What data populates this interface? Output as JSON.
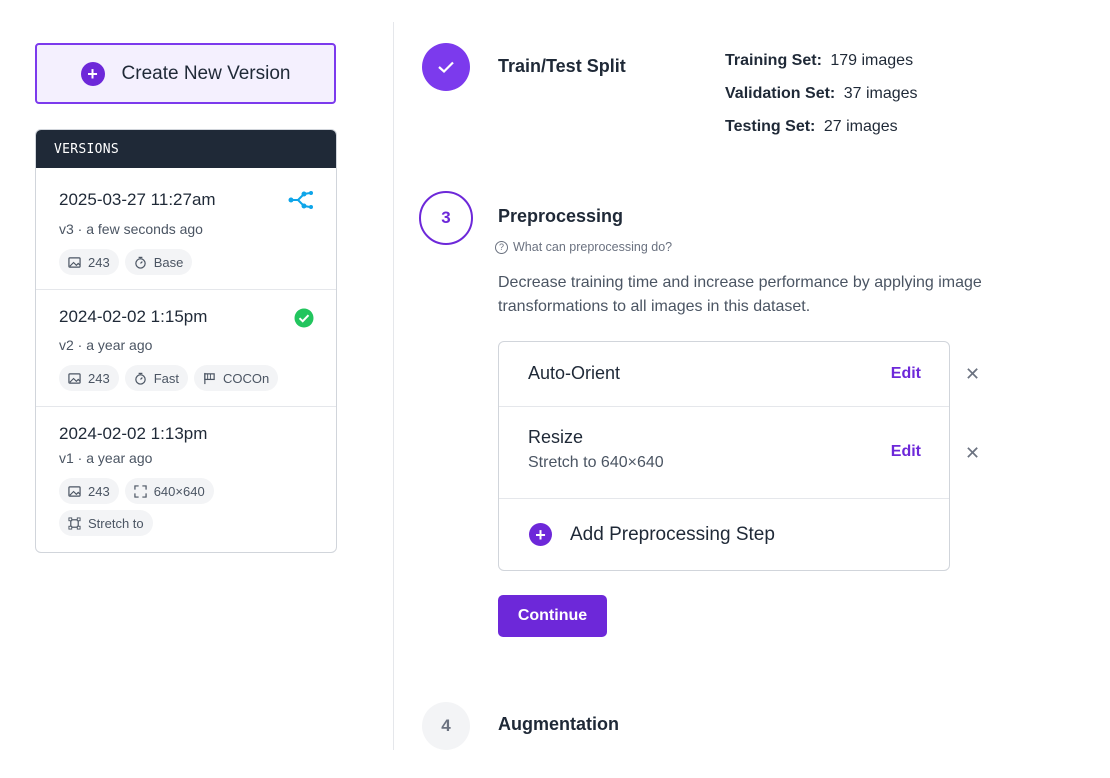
{
  "sidebar": {
    "create_label": "Create New Version",
    "versions_header": "VERSIONS",
    "versions": [
      {
        "date": "2025-03-27 11:27am",
        "subtitle": "v3 · a few seconds ago",
        "status_icon": "network-graph-icon",
        "tags": [
          {
            "icon": "image-icon",
            "text": "243"
          },
          {
            "icon": "timer-icon",
            "text": "Base"
          }
        ]
      },
      {
        "date": "2024-02-02 1:15pm",
        "subtitle": "v2 · a year ago",
        "status_icon": "check-circle-icon",
        "tags": [
          {
            "icon": "image-icon",
            "text": "243"
          },
          {
            "icon": "timer-icon",
            "text": "Fast"
          },
          {
            "icon": "flag-icon",
            "text": "COCOn"
          }
        ]
      },
      {
        "date": "2024-02-02 1:13pm",
        "subtitle": "v1 · a year ago",
        "status_icon": "",
        "tags": [
          {
            "icon": "image-icon",
            "text": "243"
          },
          {
            "icon": "expand-icon",
            "text": "640×640"
          },
          {
            "icon": "crop-icon",
            "text": "Stretch to"
          }
        ]
      }
    ]
  },
  "steps": {
    "split": {
      "title": "Train/Test Split",
      "rows": [
        {
          "label": "Training Set:",
          "value": "179 images"
        },
        {
          "label": "Validation Set:",
          "value": "37 images"
        },
        {
          "label": "Testing Set:",
          "value": "27 images"
        }
      ]
    },
    "preprocessing": {
      "number": "3",
      "title": "Preprocessing",
      "help": "What can preprocessing do?",
      "description": "Decrease training time and increase performance by applying image transformations to all images in this dataset.",
      "items": [
        {
          "name": "Auto-Orient",
          "detail": "",
          "edit": "Edit"
        },
        {
          "name": "Resize",
          "detail": "Stretch to 640×640",
          "edit": "Edit"
        }
      ],
      "add_label": "Add Preprocessing Step",
      "continue_label": "Continue"
    },
    "augmentation": {
      "number": "4",
      "title": "Augmentation"
    }
  },
  "colors": {
    "accent": "#6d28d9",
    "success": "#22c55e",
    "graph": "#0ea5e9",
    "header_bg": "#1f2937"
  }
}
